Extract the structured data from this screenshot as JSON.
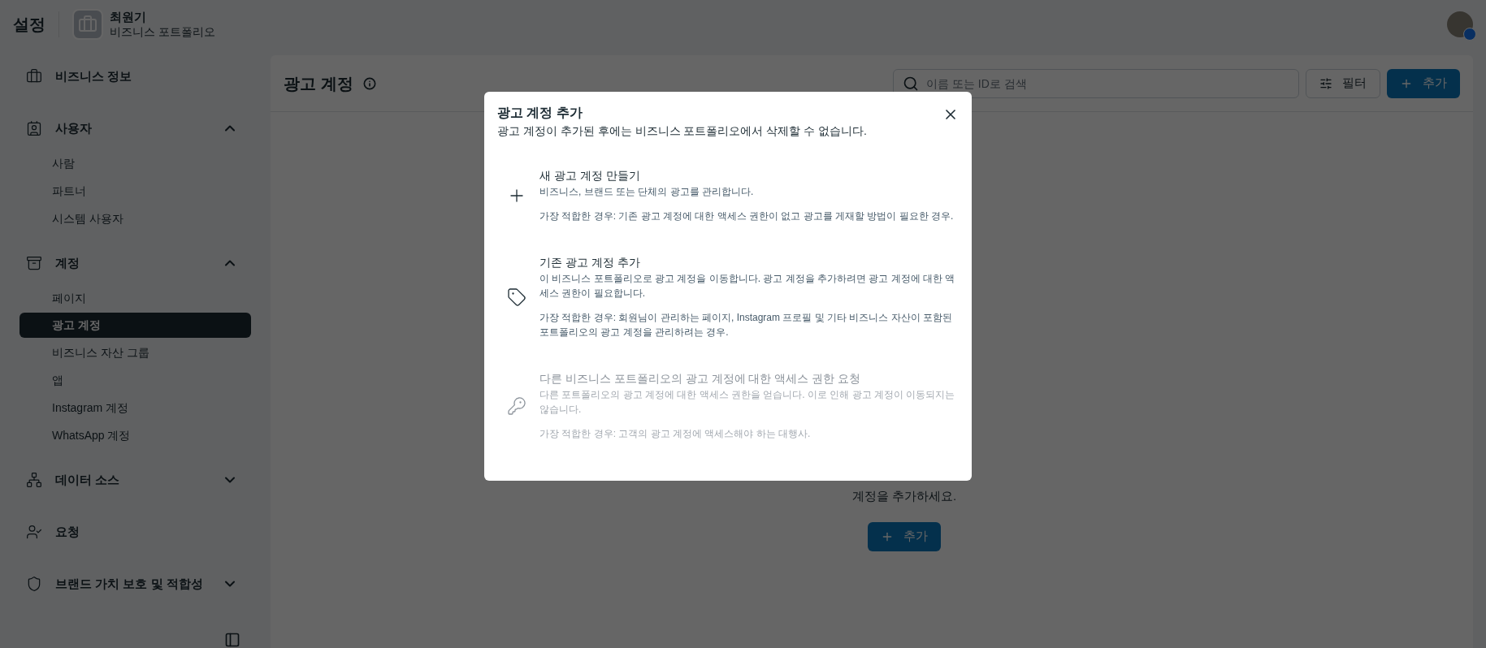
{
  "header": {
    "title": "설정",
    "portfolio_name": "최원기",
    "portfolio_type": "비즈니스 포트폴리오"
  },
  "sidebar": {
    "sections": [
      {
        "kind": "link",
        "label": "비즈니스 정보"
      },
      {
        "kind": "section",
        "label": "사용자",
        "expanded": true,
        "children": [
          {
            "label": "사람",
            "selected": false
          },
          {
            "label": "파트너",
            "selected": false
          },
          {
            "label": "시스템 사용자",
            "selected": false
          }
        ]
      },
      {
        "kind": "section",
        "label": "계정",
        "expanded": true,
        "children": [
          {
            "label": "페이지",
            "selected": false
          },
          {
            "label": "광고 계정",
            "selected": true
          },
          {
            "label": "비즈니스 자산 그룹",
            "selected": false
          },
          {
            "label": "앱",
            "selected": false
          },
          {
            "label": "Instagram 계정",
            "selected": false
          },
          {
            "label": "WhatsApp 계정",
            "selected": false
          }
        ]
      },
      {
        "kind": "section",
        "label": "데이터 소스",
        "expanded": false
      },
      {
        "kind": "link",
        "label": "요청"
      },
      {
        "kind": "section",
        "label": "브랜드 가치 보호 및 적합성",
        "expanded": false
      }
    ]
  },
  "main": {
    "title": "광고 계정",
    "search": {
      "placeholder": "이름 또는 ID로 검색"
    },
    "filter_button": "필터",
    "add_button": "추가",
    "empty_text": "계정을 추가하세요.",
    "empty_add_button": "추가"
  },
  "modal": {
    "title": "광고 계정 추가",
    "subtitle": "광고 계정이 추가된 후에는 비즈니스 포트폴리오에서 삭제할 수 없습니다.",
    "options": [
      {
        "title": "새 광고 계정 만들기",
        "description": "비즈니스, 브랜드 또는 단체의 광고를 관리합니다.",
        "best_for": "가장 적합한 경우: 기존 광고 계정에 대한 액세스 권한이 없고 광고를 게재할 방법이 필요한 경우.",
        "disabled": false
      },
      {
        "title": "기존 광고 계정 추가",
        "description": "이 비즈니스 포트폴리오로 광고 계정을 이동합니다. 광고 계정을 추가하려면 광고 계정에 대한 액세스 권한이 필요합니다.",
        "best_for": "가장 적합한 경우: 회원님이 관리하는 페이지, Instagram 프로필 및 기타 비즈니스 자산이 포함된 포트폴리오의 광고 계정을 관리하려는 경우.",
        "disabled": false
      },
      {
        "title": "다른 비즈니스 포트폴리오의 광고 계정에 대한 액세스 권한 요청",
        "description": "다른 포트폴리오의 광고 계정에 대한 액세스 권한을 얻습니다. 이로 인해 광고 계정이 이동되지는 않습니다.",
        "best_for": "가장 적합한 경우: 고객의 광고 계정에 액세스해야 하는 대행사.",
        "disabled": true
      }
    ]
  }
}
